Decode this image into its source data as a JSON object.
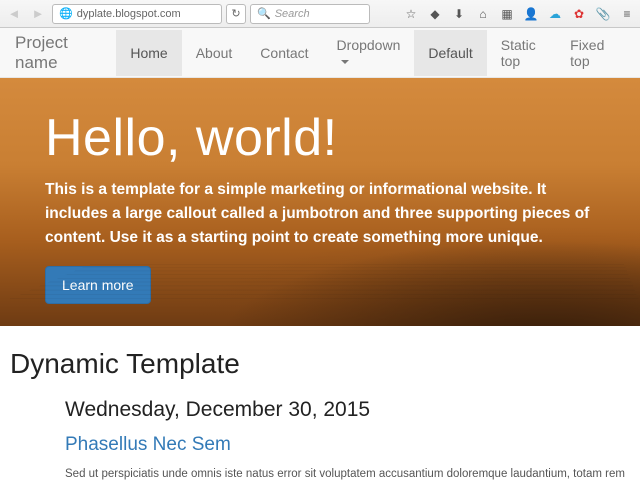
{
  "chrome": {
    "url": "dyplate.blogspot.com",
    "search_placeholder": "Search"
  },
  "navbar": {
    "brand": "Project name",
    "left": [
      {
        "label": "Home",
        "active": true
      },
      {
        "label": "About",
        "active": false
      },
      {
        "label": "Contact",
        "active": false
      },
      {
        "label": "Dropdown",
        "active": false,
        "caret": true
      }
    ],
    "right": [
      {
        "label": "Default",
        "active": true
      },
      {
        "label": "Static top",
        "active": false
      },
      {
        "label": "Fixed top",
        "active": false
      }
    ]
  },
  "jumbo": {
    "heading": "Hello, world!",
    "body": "This is a template for a simple marketing or informational website. It includes a large callout called a jumbotron and three supporting pieces of content. Use it as a starting point to create something more unique.",
    "button": "Learn more"
  },
  "content": {
    "section_title": "Dynamic Template",
    "date": "Wednesday, December 30, 2015",
    "post_title": "Phasellus Nec Sem",
    "post_body": "Sed ut perspiciatis unde omnis iste natus error sit voluptatem accusantium doloremque laudantium, totam rem"
  }
}
